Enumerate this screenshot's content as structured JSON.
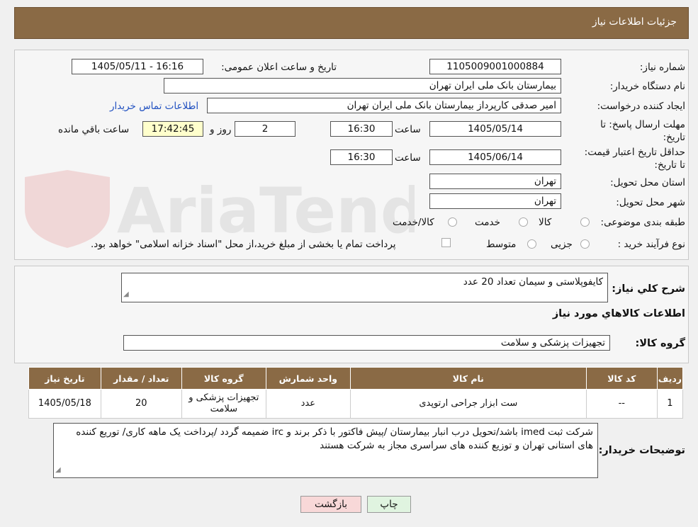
{
  "header": {
    "title": "جزئیات اطلاعات نیاز"
  },
  "form": {
    "need_number_label": "شماره نیاز:",
    "need_number": "1105009001000884",
    "announce_label": "تاریخ و ساعت اعلان عمومی:",
    "announce_value": "1405/05/11 - 16:16",
    "buyer_org_label": "نام دستگاه خریدار:",
    "buyer_org": "بیمارستان بانک ملی ایران تهران",
    "creator_label": "ایجاد کننده درخواست:",
    "creator": "امیر صدقی کارپرداز بیمارستان بانک ملی ایران تهران",
    "contact_link": "اطلاعات تماس خریدار",
    "deadline_label": "مهلت ارسال پاسخ: تا تاریخ:",
    "deadline_date": "1405/05/14",
    "time_label": "ساعت",
    "deadline_time": "16:30",
    "days_value": "2",
    "days_label": "روز و",
    "remaining_time": "17:42:45",
    "remaining_label": "ساعت باقي مانده",
    "validity_label": "حداقل تاریخ اعتبار قیمت: تا تاریخ:",
    "validity_date": "1405/06/14",
    "validity_time": "16:30",
    "province_label": "استان محل تحویل:",
    "province": "تهران",
    "city_label": "شهر محل تحویل:",
    "city": "تهران",
    "category_label": "طبقه بندی موضوعی:",
    "category_goods": "کالا",
    "category_service": "خدمت",
    "category_both": "کالا/خدمت",
    "process_label": "نوع فرآیند خرید :",
    "process_partial": "جزیی",
    "process_medium": "متوسط",
    "payment_note": "پرداخت تمام یا بخشی از مبلغ خرید،از محل \"اسناد خزانه اسلامی\" خواهد بود."
  },
  "summary": {
    "label": "شرح كلي نياز:",
    "value": "کایفوپلاستی و سیمان تعداد 20 عدد",
    "goods_section_title": "اطلاعات كالاهاي مورد نياز",
    "group_label": "گروه كالا:",
    "group_value": "تجهیزات پزشکی و سلامت"
  },
  "table": {
    "headers": [
      "رديف",
      "کد کالا",
      "نام کالا",
      "واحد شمارش",
      "گروه کالا",
      "تعداد / مقدار",
      "تاریخ نیاز"
    ],
    "rows": [
      [
        "1",
        "--",
        "ست ابزار جراحی ارتوپدی",
        "عدد",
        "تجهیزات پزشکی و سلامت",
        "20",
        "1405/05/18"
      ]
    ]
  },
  "buyer_notes": {
    "label": "توضیحات خریدار:",
    "value": "شرکت ثبت imed باشد/تحویل درب انبار بیمارستان /پیش فاکتور با ذکر برند و irc ضمیمه گردد /پرداخت یک ماهه کاری/ توریع کننده های استانی تهران و توزیع کننده های سراسری مجاز به شرکت هستند"
  },
  "buttons": {
    "print": "چاپ",
    "back": "بازگشت"
  },
  "watermark": {
    "text": "AriaTender.neT"
  },
  "colors": {
    "header_bg": "#8a6a45",
    "link": "#2050c0",
    "back_btn": "#f8d8d8",
    "print_btn": "#e0f4e0"
  }
}
